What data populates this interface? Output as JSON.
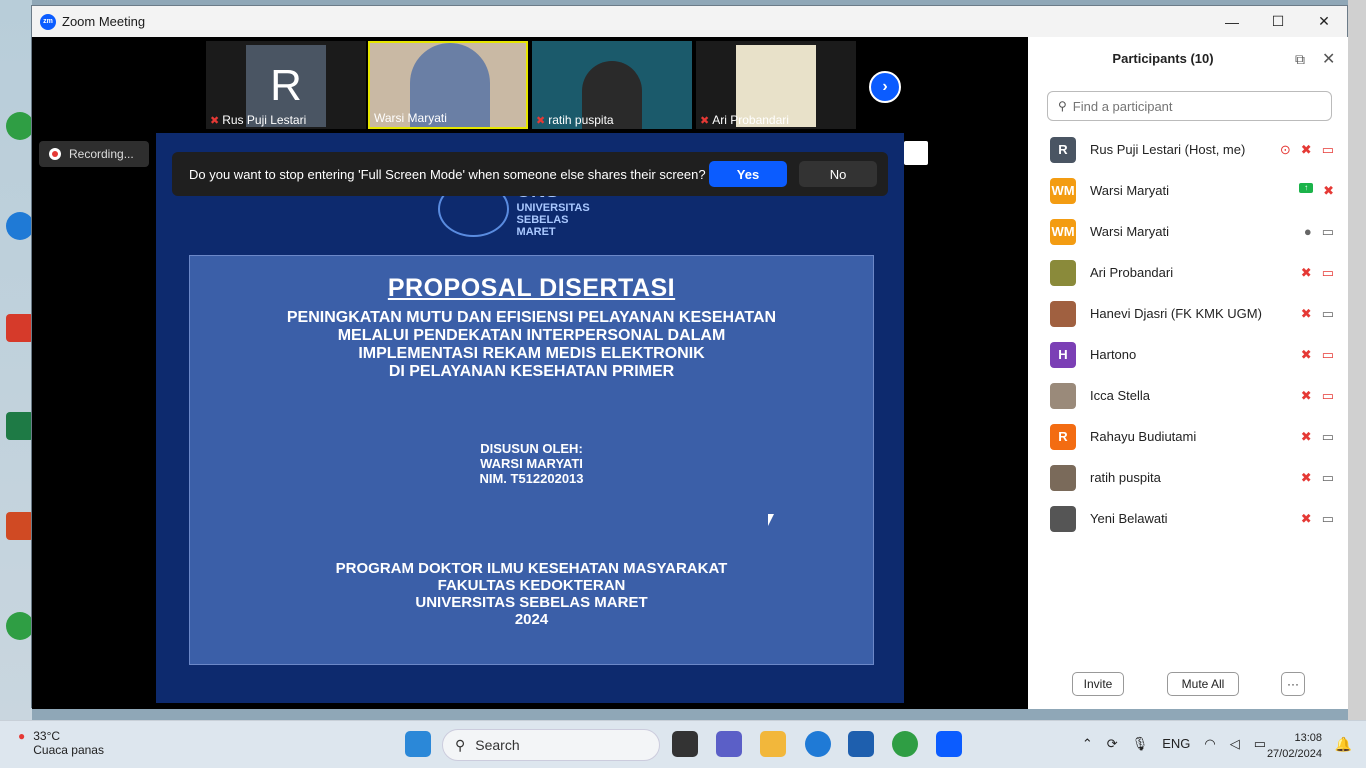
{
  "window": {
    "title": "Zoom Meeting",
    "minimize": "—",
    "maximize": "☐",
    "close": "✕"
  },
  "video_strip": {
    "tiles": [
      {
        "name": "Rus Puji Lestari",
        "initial": "R",
        "muted": true
      },
      {
        "name": "Warsi Maryati",
        "muted": false,
        "active": true
      },
      {
        "name": "ratih puspita",
        "muted": true
      },
      {
        "name": "Ari Probandari",
        "muted": true
      }
    ],
    "next": "›"
  },
  "recording": {
    "label": "Recording..."
  },
  "prompt": {
    "text": "Do you want to stop entering 'Full Screen Mode' when someone else shares their screen?",
    "yes": "Yes",
    "no": "No"
  },
  "slide": {
    "logo_text": [
      "UNS",
      "UNIVERSITAS",
      "SEBELAS MARET"
    ],
    "title": "PROPOSAL DISERTASI",
    "subtitle": [
      "PENINGKATAN MUTU DAN EFISIENSI PELAYANAN KESEHATAN",
      "MELALUI PENDEKATAN INTERPERSONAL DALAM",
      "IMPLEMENTASI REKAM MEDIS ELEKTRONIK",
      "DI PELAYANAN KESEHATAN PRIMER"
    ],
    "by": [
      "DISUSUN OLEH:",
      "WARSI MARYATI",
      "NIM. T512202013"
    ],
    "program": [
      "PROGRAM DOKTOR ILMU KESEHATAN MASYARAKAT",
      "FAKULTAS KEDOKTERAN",
      "UNIVERSITAS SEBELAS MARET",
      "2024"
    ]
  },
  "participants": {
    "title": "Participants (10)",
    "search_placeholder": "Find a participant",
    "list": [
      {
        "initials": "R",
        "color": "#4a5563",
        "name": "Rus Puji Lestari (Host, me)",
        "icons": [
          "record",
          "mic-off",
          "video-off"
        ]
      },
      {
        "initials": "WM",
        "color": "#f39c12",
        "name": "Warsi Maryati",
        "icons": [
          "share",
          "mic-off"
        ]
      },
      {
        "initials": "WM",
        "color": "#f39c12",
        "name": "Warsi Maryati",
        "icons": [
          "mic",
          "video"
        ]
      },
      {
        "initials": "",
        "color": "#8a8a3a",
        "name": "Ari Probandari",
        "icons": [
          "mic-off",
          "video-off"
        ]
      },
      {
        "initials": "",
        "color": "#a06040",
        "name": "Hanevi Djasri (FK KMK UGM)",
        "icons": [
          "mic-off",
          "video"
        ]
      },
      {
        "initials": "H",
        "color": "#7b3fb5",
        "name": "Hartono",
        "icons": [
          "mic-off",
          "video-off"
        ]
      },
      {
        "initials": "",
        "color": "#9a8a7a",
        "name": "Icca Stella",
        "icons": [
          "mic-off",
          "video-off"
        ]
      },
      {
        "initials": "R",
        "color": "#f36c12",
        "name": "Rahayu Budiutami",
        "icons": [
          "mic-off",
          "video"
        ]
      },
      {
        "initials": "",
        "color": "#7a6a5a",
        "name": "ratih puspita",
        "icons": [
          "mic-off",
          "video"
        ]
      },
      {
        "initials": "",
        "color": "#555555",
        "name": "Yeni Belawati",
        "icons": [
          "mic-off",
          "video"
        ]
      }
    ],
    "invite": "Invite",
    "mute_all": "Mute All",
    "more": "···"
  },
  "taskbar": {
    "weather_temp": "33°C",
    "weather_desc": "Cuaca panas",
    "search": "Search",
    "lang": "ENG",
    "time": "13:08",
    "date": "27/02/2024"
  }
}
